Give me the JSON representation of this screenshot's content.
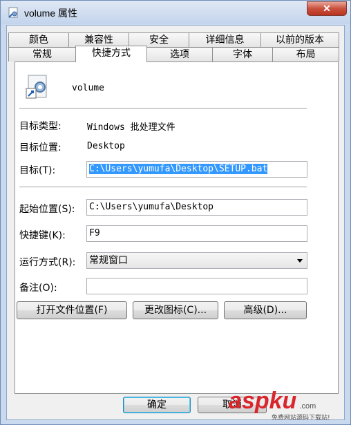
{
  "window": {
    "title": "volume 属性",
    "close_glyph": "✕"
  },
  "tabs_row1": [
    "颜色",
    "兼容性",
    "安全",
    "详细信息",
    "以前的版本"
  ],
  "tabs_row2": [
    "常规",
    "快捷方式",
    "选项",
    "字体",
    "布局"
  ],
  "active_tab": "快捷方式",
  "shortcut": {
    "name": "volume",
    "icon": "batch-shortcut-icon"
  },
  "fields": {
    "target_type_label": "目标类型:",
    "target_type_value": "Windows 批处理文件",
    "target_location_label": "目标位置:",
    "target_location_value": "Desktop",
    "target_label": "目标(T):",
    "target_value": "C:\\Users\\yumufa\\Desktop\\SETUP.bat",
    "start_in_label": "起始位置(S):",
    "start_in_value": "C:\\Users\\yumufa\\Desktop",
    "hotkey_label": "快捷键(K):",
    "hotkey_value": "F9",
    "run_label": "运行方式(R):",
    "run_value": "常规窗口",
    "comment_label": "备注(O):",
    "comment_value": ""
  },
  "buttons": {
    "open_location": "打开文件位置(F)",
    "change_icon": "更改图标(C)...",
    "advanced": "高级(D)...",
    "ok": "确定",
    "cancel": "取消"
  },
  "watermark": {
    "brand": "aspku",
    "domain": ".com",
    "tagline": "免费网站源码下载站!"
  }
}
